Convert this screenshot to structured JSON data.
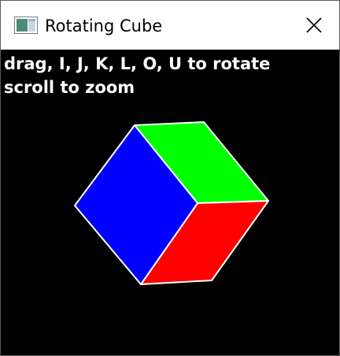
{
  "window": {
    "title": "Rotating Cube",
    "icon": "app-window-icon",
    "close_icon": "close-icon"
  },
  "hud": {
    "line1": "drag, I, J, K, L, O, U to rotate",
    "line2": "scroll to zoom"
  },
  "cube": {
    "faces": [
      {
        "name": "front-left-face",
        "color": "#0000ff"
      },
      {
        "name": "top-face",
        "color": "#00ff00"
      },
      {
        "name": "front-right-face",
        "color": "#ff0000"
      }
    ],
    "edge_color": "#ffffff",
    "background": "#000000"
  }
}
